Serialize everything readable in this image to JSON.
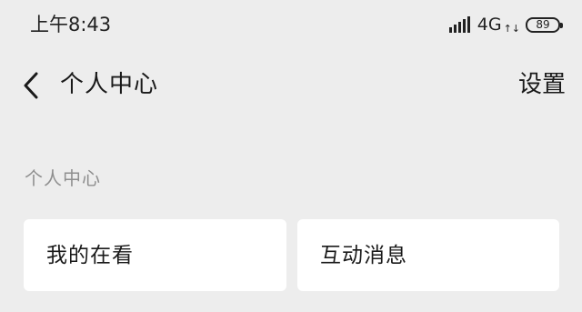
{
  "status_bar": {
    "time": "上午8:43",
    "network": "4G",
    "data_arrows": "↑↓",
    "battery": "89"
  },
  "nav": {
    "title": "个人中心",
    "settings_label": "设置",
    "back_icon": "chevron-left-icon"
  },
  "section": {
    "title": "个人中心"
  },
  "cards": [
    {
      "label": "我的在看"
    },
    {
      "label": "互动消息"
    }
  ]
}
